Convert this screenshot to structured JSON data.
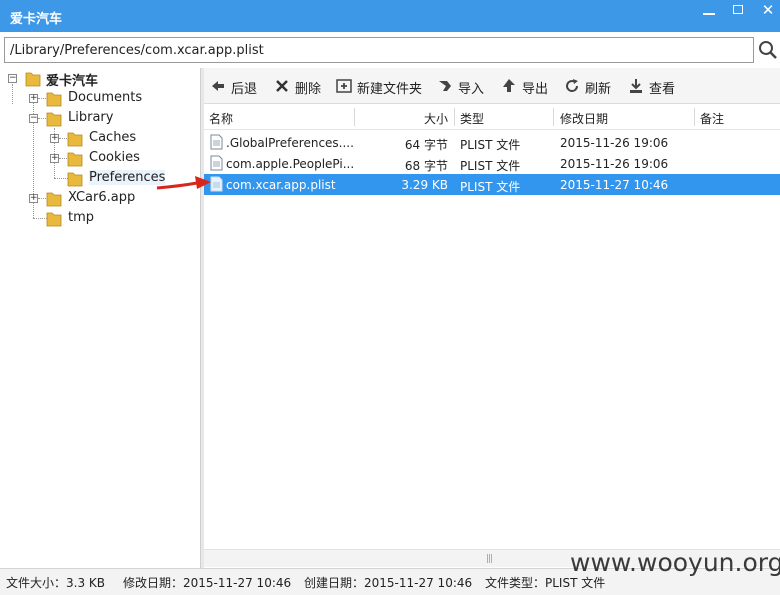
{
  "window": {
    "title": "爱卡汽车",
    "minimize_label": "minimize",
    "maximize_label": "maximize",
    "close_label": "✕"
  },
  "path_bar": {
    "value": "/Library/Preferences/com.xcar.app.plist"
  },
  "tree": {
    "root": "爱卡汽车",
    "items": [
      {
        "label": "Documents",
        "expander": "+"
      },
      {
        "label": "Library",
        "expander": "−"
      },
      {
        "label": "Caches",
        "expander": "+"
      },
      {
        "label": "Cookies",
        "expander": "+"
      },
      {
        "label": "Preferences",
        "expander": ""
      },
      {
        "label": "XCar6.app",
        "expander": "+"
      },
      {
        "label": "tmp",
        "expander": ""
      }
    ]
  },
  "toolbar": {
    "back": "后退",
    "delete": "删除",
    "new_folder": "新建文件夹",
    "import": "导入",
    "export": "导出",
    "refresh": "刷新",
    "view": "查看"
  },
  "columns": {
    "name": "名称",
    "size": "大小",
    "type": "类型",
    "modified": "修改日期",
    "note": "备注"
  },
  "files": [
    {
      "name": ".GlobalPreferences....",
      "size": "64 字节",
      "type": "PLIST 文件",
      "modified": "2015-11-26 19:06",
      "selected": false
    },
    {
      "name": "com.apple.PeoplePi...",
      "size": "68 字节",
      "type": "PLIST 文件",
      "modified": "2015-11-26 19:06",
      "selected": false
    },
    {
      "name": "com.xcar.app.plist",
      "size": "3.29 KB",
      "type": "PLIST 文件",
      "modified": "2015-11-27 10:46",
      "selected": true
    }
  ],
  "status": {
    "file_size": "文件大小：3.3 KB",
    "modified": "修改日期：2015-11-27 10:46",
    "created": "创建日期：2015-11-27 10:46",
    "file_type": "文件类型：PLIST 文件"
  },
  "watermark": "www.wooyun.org",
  "colors": {
    "titlebar": "#3d98e8",
    "selection": "#3296ee",
    "folder": "#e8b93c",
    "arrow": "#d9261c"
  }
}
